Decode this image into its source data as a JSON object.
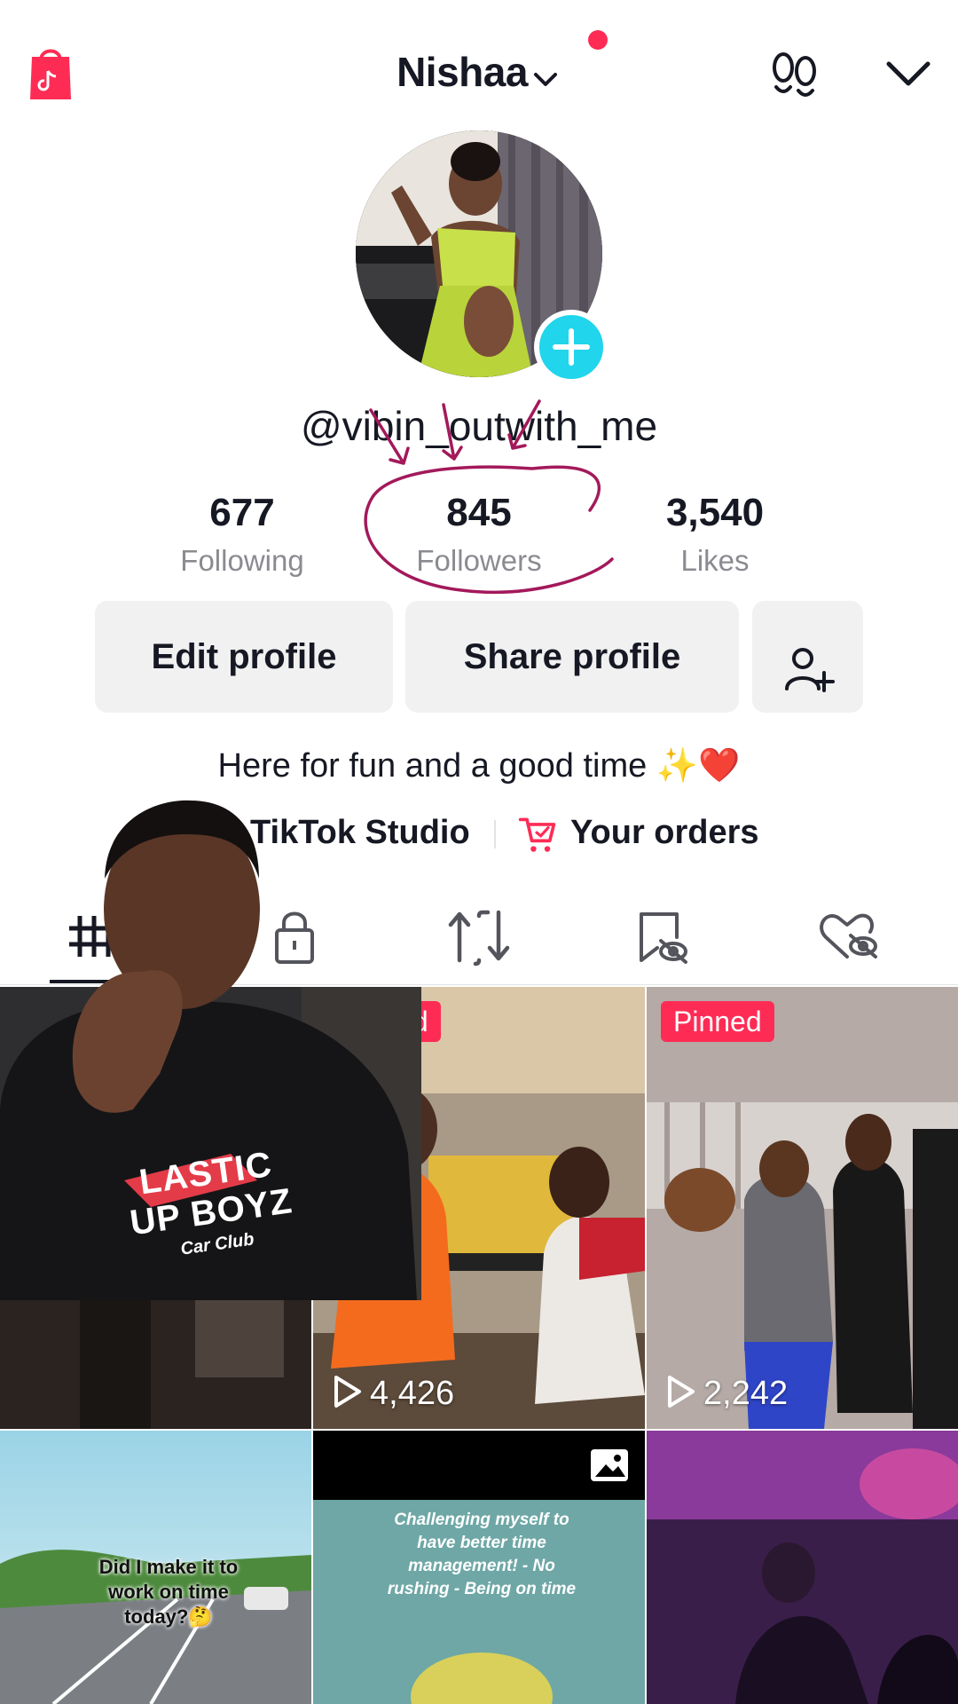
{
  "header": {
    "account_name": "Nishaa",
    "icons": [
      "shop-bag-icon",
      "chevron-down-icon",
      "footprint-icon",
      "chevron-down-icon"
    ]
  },
  "profile": {
    "username": "@vibin_outwith_me",
    "stats": [
      {
        "value": "677",
        "label": "Following"
      },
      {
        "value": "845",
        "label": "Followers"
      },
      {
        "value": "3,540",
        "label": "Likes"
      }
    ],
    "buttons": {
      "edit": "Edit profile",
      "share": "Share profile"
    },
    "bio": "Here for fun and a good time ✨❤️",
    "links": {
      "studio": "TikTok Studio",
      "orders": "Your orders"
    }
  },
  "tabs": [
    "grid-icon",
    "lock-icon",
    "repost-icon",
    "saved-icon",
    "liked-icon"
  ],
  "grid": {
    "tiles": [
      {
        "pinned": "",
        "views": ""
      },
      {
        "pinned": "Pinned",
        "views": "4,426"
      },
      {
        "pinned": "Pinned",
        "views": "2,242"
      },
      {
        "pinned": "",
        "views": "",
        "overlay_text": "Did I make it to work on time today?🤔"
      },
      {
        "pinned": "",
        "views": "",
        "overlay_text": "Challenging myself to have better time management! - No rushing - Being on time"
      },
      {
        "pinned": "",
        "views": ""
      }
    ]
  },
  "reaction_overlay": {
    "shirt_text": "LASTIC UP BOYZ",
    "shirt_subtext": "Car Club"
  },
  "colors": {
    "accent": "#fe2c55",
    "add_badge": "#20d5ec",
    "annotation": "#a3195b",
    "button_bg": "#f1f1f2",
    "muted_text": "#8a8b91"
  }
}
